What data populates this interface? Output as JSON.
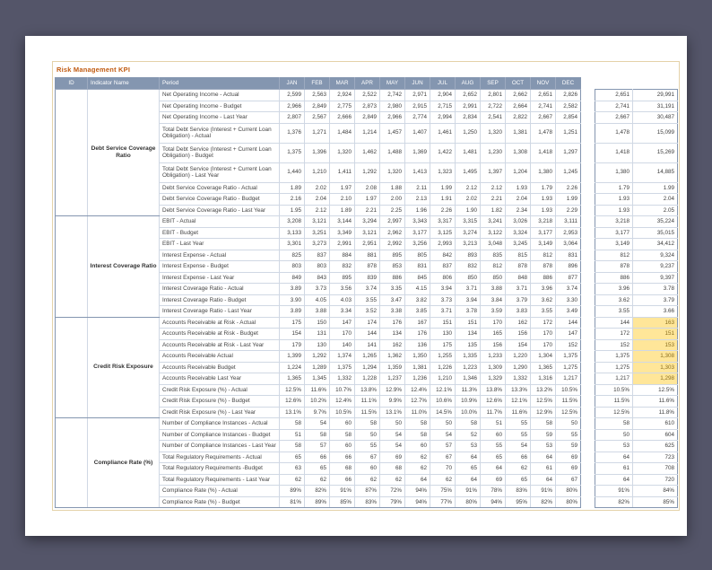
{
  "page": {
    "title": "Risk Management KPI"
  },
  "colors": {
    "title": "#C05B11",
    "header_bg": "#8496B0",
    "highlight": "#FFE699"
  },
  "table": {
    "headers": {
      "id": "ID",
      "indicator": "Indicator Name",
      "period": "Period"
    },
    "months": [
      "JAN",
      "FEB",
      "MAR",
      "APR",
      "MAY",
      "JUN",
      "JUL",
      "AUG",
      "SEP",
      "OCT",
      "NOV",
      "DEC"
    ],
    "groups": [
      {
        "name": "Debt Service Coverage Ratio",
        "rows": [
          {
            "period": "Net Operating Income - Actual",
            "values": [
              "2,599",
              "2,563",
              "2,924",
              "2,522",
              "2,742",
              "2,971",
              "2,904",
              "2,652",
              "2,801",
              "2,662",
              "2,651",
              "2,826"
            ],
            "s1": "2,651",
            "s2": "29,991"
          },
          {
            "period": "Net Operating Income - Budget",
            "values": [
              "2,966",
              "2,849",
              "2,775",
              "2,873",
              "2,980",
              "2,915",
              "2,715",
              "2,991",
              "2,722",
              "2,664",
              "2,741",
              "2,582"
            ],
            "s1": "2,741",
            "s2": "31,191"
          },
          {
            "period": "Net Operating Income - Last Year",
            "values": [
              "2,807",
              "2,567",
              "2,666",
              "2,849",
              "2,966",
              "2,774",
              "2,994",
              "2,834",
              "2,541",
              "2,822",
              "2,667",
              "2,854"
            ],
            "s1": "2,667",
            "s2": "30,487"
          },
          {
            "period": "Total Debt Service (Interest + Current Loan Obligation) - Actual",
            "tall": true,
            "values": [
              "1,376",
              "1,271",
              "1,484",
              "1,214",
              "1,457",
              "1,407",
              "1,461",
              "1,250",
              "1,320",
              "1,381",
              "1,478",
              "1,251"
            ],
            "s1": "1,478",
            "s2": "15,099"
          },
          {
            "period": "Total Debt Service (Interest + Current Loan Obligation) - Budget",
            "tall": true,
            "values": [
              "1,375",
              "1,396",
              "1,320",
              "1,462",
              "1,488",
              "1,369",
              "1,422",
              "1,481",
              "1,230",
              "1,308",
              "1,418",
              "1,297"
            ],
            "s1": "1,418",
            "s2": "15,269"
          },
          {
            "period": "Total Debt Service (Interest + Current Loan Obligation) - Last Year",
            "tall": true,
            "values": [
              "1,440",
              "1,210",
              "1,411",
              "1,292",
              "1,320",
              "1,413",
              "1,323",
              "1,495",
              "1,397",
              "1,204",
              "1,380",
              "1,245"
            ],
            "s1": "1,380",
            "s2": "14,885"
          },
          {
            "period": "Debt Service Coverage Ratio - Actual",
            "values": [
              "1.89",
              "2.02",
              "1.97",
              "2.08",
              "1.88",
              "2.11",
              "1.99",
              "2.12",
              "2.12",
              "1.93",
              "1.79",
              "2.26"
            ],
            "s1": "1.79",
            "s2": "1.99"
          },
          {
            "period": "Debt Service Coverage Ratio - Budget",
            "values": [
              "2.16",
              "2.04",
              "2.10",
              "1.97",
              "2.00",
              "2.13",
              "1.91",
              "2.02",
              "2.21",
              "2.04",
              "1.93",
              "1.99"
            ],
            "s1": "1.93",
            "s2": "2.04"
          },
          {
            "period": "Debt Service Coverage Ratio - Last Year",
            "values": [
              "1.95",
              "2.12",
              "1.89",
              "2.21",
              "2.25",
              "1.96",
              "2.26",
              "1.90",
              "1.82",
              "2.34",
              "1.93",
              "2.29"
            ],
            "s1": "1.93",
            "s2": "2.05"
          }
        ]
      },
      {
        "name": "Interest Coverage Ratio",
        "rows": [
          {
            "period": "EBIT - Actual",
            "values": [
              "3,208",
              "3,121",
              "3,144",
              "3,294",
              "2,997",
              "3,343",
              "3,317",
              "3,315",
              "3,241",
              "3,026",
              "3,218",
              "3,111"
            ],
            "s1": "3,218",
            "s2": "35,224"
          },
          {
            "period": "EBIT - Budget",
            "values": [
              "3,133",
              "3,251",
              "3,349",
              "3,121",
              "2,962",
              "3,177",
              "3,125",
              "3,274",
              "3,122",
              "3,324",
              "3,177",
              "2,953"
            ],
            "s1": "3,177",
            "s2": "35,015"
          },
          {
            "period": "EBIT - Last Year",
            "values": [
              "3,301",
              "3,273",
              "2,991",
              "2,951",
              "2,992",
              "3,256",
              "2,993",
              "3,213",
              "3,048",
              "3,245",
              "3,149",
              "3,064"
            ],
            "s1": "3,149",
            "s2": "34,412"
          },
          {
            "period": "Interest Expense - Actual",
            "values": [
              "825",
              "837",
              "884",
              "881",
              "895",
              "805",
              "842",
              "893",
              "835",
              "815",
              "812",
              "831"
            ],
            "s1": "812",
            "s2": "9,324"
          },
          {
            "period": "Interest Expense - Budget",
            "values": [
              "803",
              "803",
              "832",
              "878",
              "853",
              "831",
              "837",
              "832",
              "812",
              "878",
              "878",
              "896"
            ],
            "s1": "878",
            "s2": "9,237"
          },
          {
            "period": "Interest Expense - Last Year",
            "values": [
              "849",
              "843",
              "895",
              "839",
              "886",
              "845",
              "806",
              "850",
              "850",
              "848",
              "886",
              "877"
            ],
            "s1": "886",
            "s2": "9,397"
          },
          {
            "period": "Interest Coverage Ratio - Actual",
            "values": [
              "3.89",
              "3.73",
              "3.56",
              "3.74",
              "3.35",
              "4.15",
              "3.94",
              "3.71",
              "3.88",
              "3.71",
              "3.96",
              "3.74"
            ],
            "s1": "3.96",
            "s2": "3.78"
          },
          {
            "period": "Interest Coverage Ratio - Budget",
            "values": [
              "3.90",
              "4.05",
              "4.03",
              "3.55",
              "3.47",
              "3.82",
              "3.73",
              "3.94",
              "3.84",
              "3.79",
              "3.62",
              "3.30"
            ],
            "s1": "3.62",
            "s2": "3.79"
          },
          {
            "period": "Interest Coverage Ratio - Last Year",
            "values": [
              "3.89",
              "3.88",
              "3.34",
              "3.52",
              "3.38",
              "3.85",
              "3.71",
              "3.78",
              "3.59",
              "3.83",
              "3.55",
              "3.49"
            ],
            "s1": "3.55",
            "s2": "3.66"
          }
        ]
      },
      {
        "name": "Credit Risk Exposure",
        "rows": [
          {
            "period": "Accounts Receivable at Risk - Actual",
            "hl": true,
            "values": [
              "175",
              "150",
              "147",
              "174",
              "176",
              "167",
              "151",
              "151",
              "170",
              "162",
              "172",
              "144"
            ],
            "s1": "144",
            "s2": "163"
          },
          {
            "period": "Accounts Receivable at Risk - Budget",
            "hl": true,
            "values": [
              "154",
              "131",
              "170",
              "144",
              "134",
              "176",
              "130",
              "134",
              "165",
              "156",
              "170",
              "147"
            ],
            "s1": "172",
            "s2": "151"
          },
          {
            "period": "Accounts Receivable at Risk - Last Year",
            "hl": true,
            "values": [
              "179",
              "130",
              "140",
              "141",
              "162",
              "136",
              "175",
              "135",
              "156",
              "154",
              "170",
              "152"
            ],
            "s1": "152",
            "s2": "153"
          },
          {
            "period": "Accounts Receivable Actual",
            "hl": true,
            "values": [
              "1,399",
              "1,292",
              "1,374",
              "1,265",
              "1,362",
              "1,350",
              "1,255",
              "1,335",
              "1,233",
              "1,220",
              "1,304",
              "1,375"
            ],
            "s1": "1,375",
            "s2": "1,308"
          },
          {
            "period": "Accounts Receivable Budget",
            "hl": true,
            "values": [
              "1,224",
              "1,289",
              "1,375",
              "1,294",
              "1,359",
              "1,381",
              "1,226",
              "1,223",
              "1,309",
              "1,290",
              "1,365",
              "1,275"
            ],
            "s1": "1,275",
            "s2": "1,303"
          },
          {
            "period": "Accounts Receivable Last Year",
            "hl": true,
            "values": [
              "1,365",
              "1,345",
              "1,332",
              "1,228",
              "1,237",
              "1,236",
              "1,210",
              "1,346",
              "1,329",
              "1,332",
              "1,316",
              "1,217"
            ],
            "s1": "1,217",
            "s2": "1,298"
          },
          {
            "period": "Credit Risk Exposure (%) - Actual",
            "values": [
              "12.5%",
              "11.6%",
              "10.7%",
              "13.8%",
              "12.9%",
              "12.4%",
              "12.1%",
              "11.3%",
              "13.8%",
              "13.3%",
              "13.2%",
              "10.5%"
            ],
            "s1": "10.5%",
            "s2": "12.5%"
          },
          {
            "period": "Credit Risk Exposure (%) - Budget",
            "values": [
              "12.6%",
              "10.2%",
              "12.4%",
              "11.1%",
              "9.9%",
              "12.7%",
              "10.6%",
              "10.9%",
              "12.6%",
              "12.1%",
              "12.5%",
              "11.5%"
            ],
            "s1": "11.5%",
            "s2": "11.6%"
          },
          {
            "period": "Credit Risk Exposure (%) - Last Year",
            "values": [
              "13.1%",
              "9.7%",
              "10.5%",
              "11.5%",
              "13.1%",
              "11.0%",
              "14.5%",
              "10.0%",
              "11.7%",
              "11.6%",
              "12.9%",
              "12.5%"
            ],
            "s1": "12.5%",
            "s2": "11.8%"
          }
        ]
      },
      {
        "name": "Compliance Rate (%)",
        "rows": [
          {
            "period": "Number of Compliance Instances - Actual",
            "values": [
              "58",
              "54",
              "60",
              "58",
              "50",
              "58",
              "50",
              "58",
              "51",
              "55",
              "58",
              "50"
            ],
            "s1": "58",
            "s2": "610"
          },
          {
            "period": "Number of Compliance Instances - Budget",
            "values": [
              "51",
              "58",
              "58",
              "50",
              "54",
              "58",
              "54",
              "52",
              "60",
              "55",
              "59",
              "55"
            ],
            "s1": "50",
            "s2": "604"
          },
          {
            "period": "Number of Compliance Instances - Last Year",
            "values": [
              "58",
              "57",
              "60",
              "55",
              "54",
              "60",
              "57",
              "53",
              "55",
              "54",
              "53",
              "59"
            ],
            "s1": "53",
            "s2": "625"
          },
          {
            "period": "Total Regulatory Requirements - Actual",
            "values": [
              "65",
              "66",
              "66",
              "67",
              "69",
              "62",
              "67",
              "64",
              "65",
              "66",
              "64",
              "69"
            ],
            "s1": "64",
            "s2": "723"
          },
          {
            "period": "Total Regulatory Requirements -Budget",
            "values": [
              "63",
              "65",
              "68",
              "60",
              "68",
              "62",
              "70",
              "65",
              "64",
              "62",
              "61",
              "69"
            ],
            "s1": "61",
            "s2": "708"
          },
          {
            "period": "Total Regulatory Requirements - Last Year",
            "values": [
              "62",
              "62",
              "66",
              "62",
              "62",
              "64",
              "62",
              "64",
              "69",
              "65",
              "64",
              "67"
            ],
            "s1": "64",
            "s2": "720"
          },
          {
            "period": "Compliance Rate (%) - Actual",
            "values": [
              "89%",
              "82%",
              "91%",
              "87%",
              "72%",
              "94%",
              "75%",
              "91%",
              "78%",
              "83%",
              "91%",
              "80%"
            ],
            "s1": "91%",
            "s2": "84%"
          },
          {
            "period": "Compliance Rate (%) - Budget",
            "values": [
              "81%",
              "89%",
              "85%",
              "83%",
              "79%",
              "94%",
              "77%",
              "80%",
              "94%",
              "95%",
              "82%",
              "80%"
            ],
            "s1": "82%",
            "s2": "85%"
          }
        ]
      }
    ]
  }
}
